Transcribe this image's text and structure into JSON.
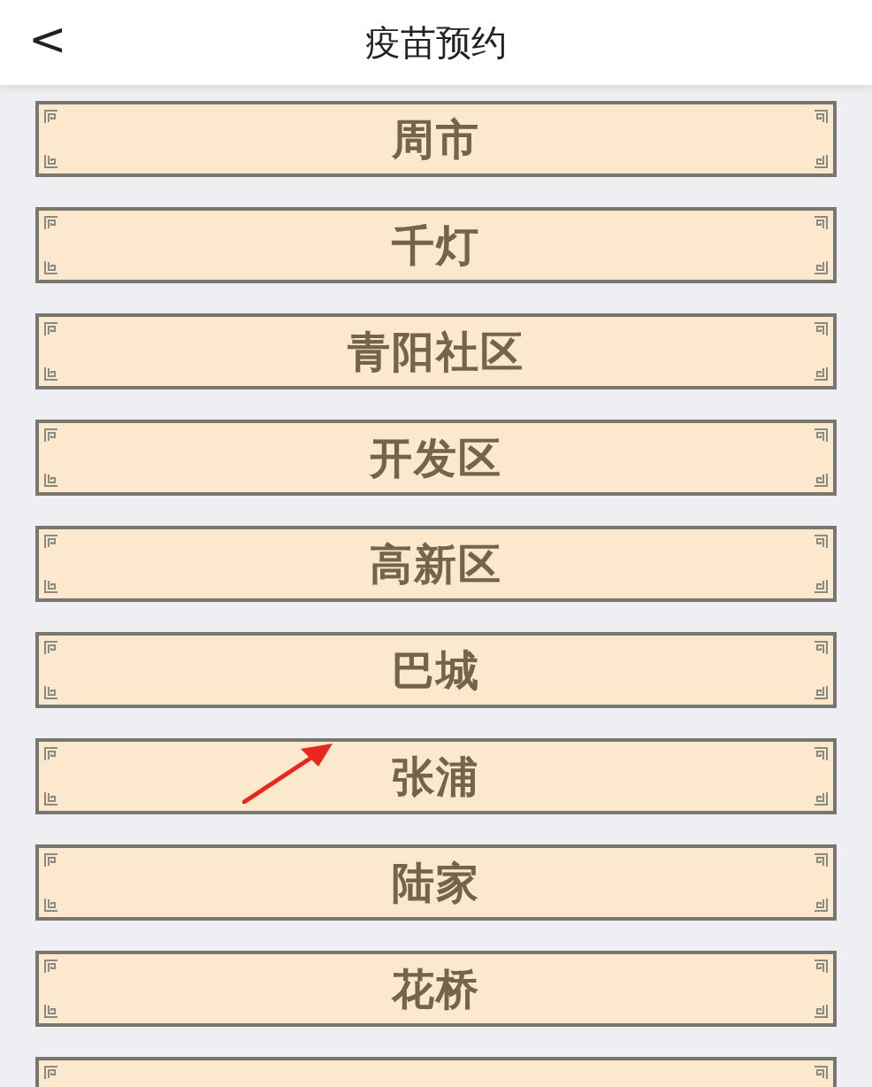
{
  "header": {
    "back": "<",
    "title": "疫苗预约"
  },
  "districts": [
    {
      "name": "周市"
    },
    {
      "name": "千灯"
    },
    {
      "name": "青阳社区"
    },
    {
      "name": "开发区"
    },
    {
      "name": "高新区"
    },
    {
      "name": "巴城"
    },
    {
      "name": "张浦"
    },
    {
      "name": "陆家"
    },
    {
      "name": "花桥"
    }
  ]
}
